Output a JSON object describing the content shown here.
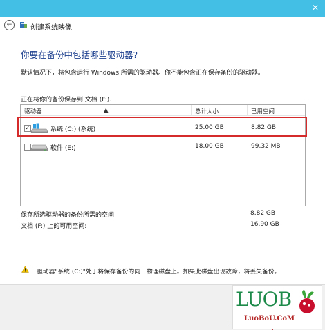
{
  "window": {
    "title": "创建系统映像",
    "close_glyph": "✕",
    "back_glyph": "←"
  },
  "page": {
    "heading": "你要在备份中包括哪些驱动器?",
    "description": "默认情况下，将包含运行 Windows 所需的驱动器。你不能包含正在保存备份的驱动器。",
    "saving_to": "正在将你的备份保存到 文档 (F:)."
  },
  "drives_table": {
    "columns": [
      "驱动器",
      "总计大小",
      "已用空间"
    ],
    "rows": [
      {
        "checked": true,
        "check_glyph": "✓",
        "name": "系统 (C:) (系统)",
        "total": "25.00 GB",
        "used": "8.82 GB"
      },
      {
        "checked": false,
        "check_glyph": "",
        "name": "软件 (E:)",
        "total": "18.00 GB",
        "used": "99.32 MB"
      }
    ]
  },
  "summary": {
    "required_label": "保存所选驱动器的备份所需的空间:",
    "required_value": "8.82 GB",
    "available_label": "文档 (F:) 上的可用空间:",
    "available_value": "16.90 GB"
  },
  "warning": {
    "text": "驱动器\"系统 (C:)\"处于将保存备份的同一物理磁盘上。如果此磁盘出现故障，将丢失备份。"
  },
  "watermark": {
    "brand": "LUOB",
    "url": "LuoBoU.CoM"
  },
  "colors": {
    "titlebar": "#43bfe6",
    "heading": "#1c3f8e",
    "highlight": "#d62b2b"
  }
}
